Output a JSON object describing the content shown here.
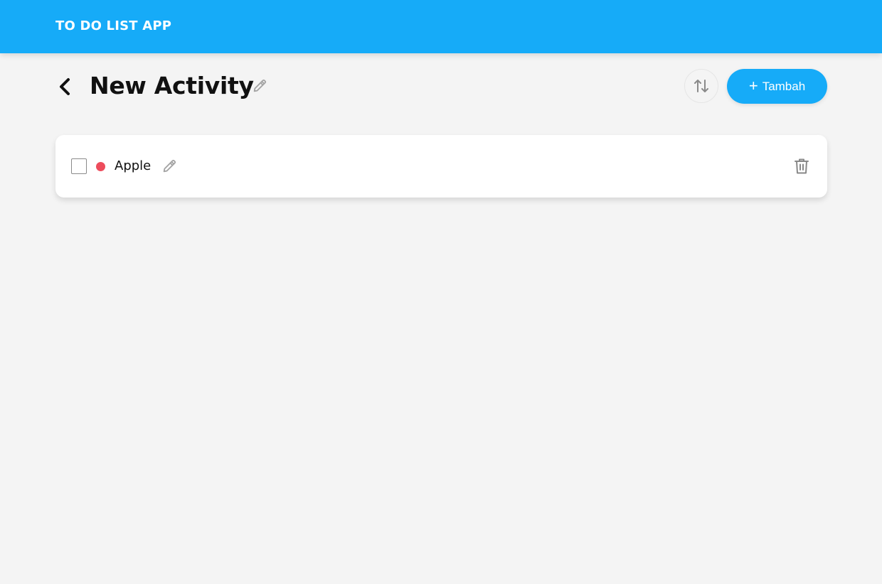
{
  "header": {
    "title": "TO DO LIST APP",
    "background_color": "#16abf8"
  },
  "activity": {
    "title": "New Activity",
    "back_icon": "chevron-left-icon",
    "edit_icon": "pencil-icon"
  },
  "toolbar": {
    "sort_icon": "sort-arrows-icon",
    "add_button": {
      "icon": "plus-icon",
      "plus_glyph": "+",
      "label": "Tambah",
      "color": "#16abf8"
    }
  },
  "todos": [
    {
      "title": "Apple",
      "checked": false,
      "priority_color": "#ed4c5c",
      "edit_icon": "pencil-icon",
      "delete_icon": "trash-icon"
    }
  ]
}
